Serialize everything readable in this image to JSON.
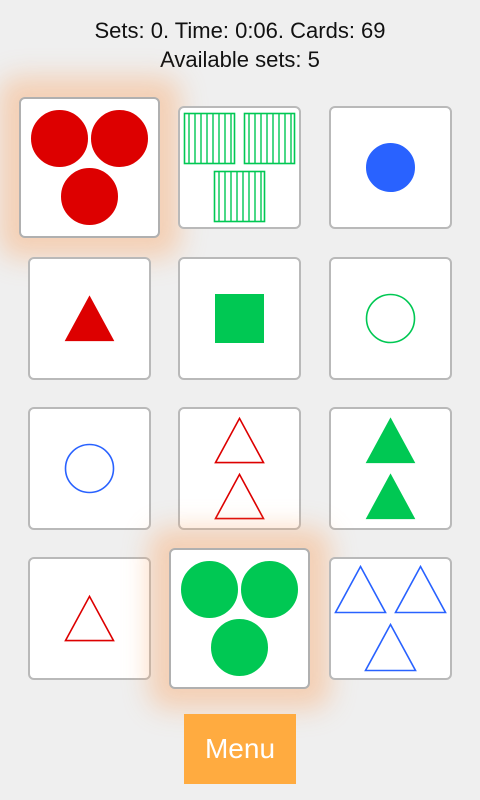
{
  "status": {
    "line1": "Sets: 0. Time: 0:06. Cards: 69",
    "line2": "Available sets: 5"
  },
  "colors": {
    "red": "#dd0000",
    "green": "#00c853",
    "blue": "#2962ff",
    "menu": "#ffab40",
    "glow": "#ffaa6e"
  },
  "cards": [
    {
      "shape": "circle",
      "color": "red",
      "count": 3,
      "fill": "solid",
      "selected": true
    },
    {
      "shape": "square",
      "color": "green",
      "count": 3,
      "fill": "striped",
      "selected": false
    },
    {
      "shape": "circle",
      "color": "blue",
      "count": 1,
      "fill": "solid",
      "selected": false
    },
    {
      "shape": "triangle",
      "color": "red",
      "count": 1,
      "fill": "solid",
      "selected": false
    },
    {
      "shape": "square",
      "color": "green",
      "count": 1,
      "fill": "solid",
      "selected": false
    },
    {
      "shape": "circle",
      "color": "green",
      "count": 1,
      "fill": "outline",
      "selected": false
    },
    {
      "shape": "circle",
      "color": "blue",
      "count": 1,
      "fill": "outline",
      "selected": false
    },
    {
      "shape": "triangle",
      "color": "red",
      "count": 2,
      "fill": "outline",
      "selected": false
    },
    {
      "shape": "triangle",
      "color": "green",
      "count": 2,
      "fill": "solid",
      "selected": false
    },
    {
      "shape": "triangle",
      "color": "red",
      "count": 1,
      "fill": "outline",
      "selected": false
    },
    {
      "shape": "circle",
      "color": "green",
      "count": 3,
      "fill": "solid",
      "selected": true
    },
    {
      "shape": "triangle",
      "color": "blue",
      "count": 3,
      "fill": "outline",
      "selected": false
    }
  ],
  "menu": {
    "label": "Menu"
  }
}
